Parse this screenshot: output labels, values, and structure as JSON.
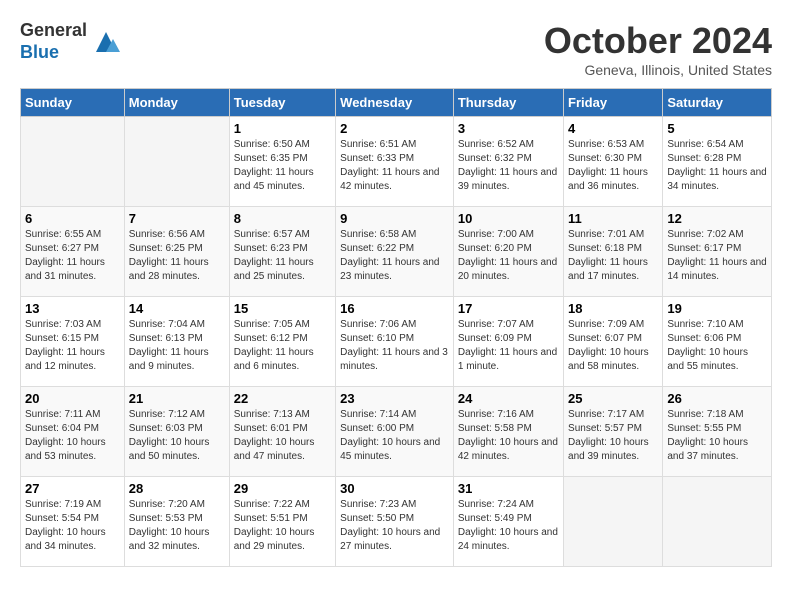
{
  "logo": {
    "general": "General",
    "blue": "Blue"
  },
  "title": "October 2024",
  "subtitle": "Geneva, Illinois, United States",
  "days_of_week": [
    "Sunday",
    "Monday",
    "Tuesday",
    "Wednesday",
    "Thursday",
    "Friday",
    "Saturday"
  ],
  "weeks": [
    [
      {
        "day": "",
        "empty": true
      },
      {
        "day": "",
        "empty": true
      },
      {
        "day": "1",
        "sunrise": "Sunrise: 6:50 AM",
        "sunset": "Sunset: 6:35 PM",
        "daylight": "Daylight: 11 hours and 45 minutes."
      },
      {
        "day": "2",
        "sunrise": "Sunrise: 6:51 AM",
        "sunset": "Sunset: 6:33 PM",
        "daylight": "Daylight: 11 hours and 42 minutes."
      },
      {
        "day": "3",
        "sunrise": "Sunrise: 6:52 AM",
        "sunset": "Sunset: 6:32 PM",
        "daylight": "Daylight: 11 hours and 39 minutes."
      },
      {
        "day": "4",
        "sunrise": "Sunrise: 6:53 AM",
        "sunset": "Sunset: 6:30 PM",
        "daylight": "Daylight: 11 hours and 36 minutes."
      },
      {
        "day": "5",
        "sunrise": "Sunrise: 6:54 AM",
        "sunset": "Sunset: 6:28 PM",
        "daylight": "Daylight: 11 hours and 34 minutes."
      }
    ],
    [
      {
        "day": "6",
        "sunrise": "Sunrise: 6:55 AM",
        "sunset": "Sunset: 6:27 PM",
        "daylight": "Daylight: 11 hours and 31 minutes."
      },
      {
        "day": "7",
        "sunrise": "Sunrise: 6:56 AM",
        "sunset": "Sunset: 6:25 PM",
        "daylight": "Daylight: 11 hours and 28 minutes."
      },
      {
        "day": "8",
        "sunrise": "Sunrise: 6:57 AM",
        "sunset": "Sunset: 6:23 PM",
        "daylight": "Daylight: 11 hours and 25 minutes."
      },
      {
        "day": "9",
        "sunrise": "Sunrise: 6:58 AM",
        "sunset": "Sunset: 6:22 PM",
        "daylight": "Daylight: 11 hours and 23 minutes."
      },
      {
        "day": "10",
        "sunrise": "Sunrise: 7:00 AM",
        "sunset": "Sunset: 6:20 PM",
        "daylight": "Daylight: 11 hours and 20 minutes."
      },
      {
        "day": "11",
        "sunrise": "Sunrise: 7:01 AM",
        "sunset": "Sunset: 6:18 PM",
        "daylight": "Daylight: 11 hours and 17 minutes."
      },
      {
        "day": "12",
        "sunrise": "Sunrise: 7:02 AM",
        "sunset": "Sunset: 6:17 PM",
        "daylight": "Daylight: 11 hours and 14 minutes."
      }
    ],
    [
      {
        "day": "13",
        "sunrise": "Sunrise: 7:03 AM",
        "sunset": "Sunset: 6:15 PM",
        "daylight": "Daylight: 11 hours and 12 minutes."
      },
      {
        "day": "14",
        "sunrise": "Sunrise: 7:04 AM",
        "sunset": "Sunset: 6:13 PM",
        "daylight": "Daylight: 11 hours and 9 minutes."
      },
      {
        "day": "15",
        "sunrise": "Sunrise: 7:05 AM",
        "sunset": "Sunset: 6:12 PM",
        "daylight": "Daylight: 11 hours and 6 minutes."
      },
      {
        "day": "16",
        "sunrise": "Sunrise: 7:06 AM",
        "sunset": "Sunset: 6:10 PM",
        "daylight": "Daylight: 11 hours and 3 minutes."
      },
      {
        "day": "17",
        "sunrise": "Sunrise: 7:07 AM",
        "sunset": "Sunset: 6:09 PM",
        "daylight": "Daylight: 11 hours and 1 minute."
      },
      {
        "day": "18",
        "sunrise": "Sunrise: 7:09 AM",
        "sunset": "Sunset: 6:07 PM",
        "daylight": "Daylight: 10 hours and 58 minutes."
      },
      {
        "day": "19",
        "sunrise": "Sunrise: 7:10 AM",
        "sunset": "Sunset: 6:06 PM",
        "daylight": "Daylight: 10 hours and 55 minutes."
      }
    ],
    [
      {
        "day": "20",
        "sunrise": "Sunrise: 7:11 AM",
        "sunset": "Sunset: 6:04 PM",
        "daylight": "Daylight: 10 hours and 53 minutes."
      },
      {
        "day": "21",
        "sunrise": "Sunrise: 7:12 AM",
        "sunset": "Sunset: 6:03 PM",
        "daylight": "Daylight: 10 hours and 50 minutes."
      },
      {
        "day": "22",
        "sunrise": "Sunrise: 7:13 AM",
        "sunset": "Sunset: 6:01 PM",
        "daylight": "Daylight: 10 hours and 47 minutes."
      },
      {
        "day": "23",
        "sunrise": "Sunrise: 7:14 AM",
        "sunset": "Sunset: 6:00 PM",
        "daylight": "Daylight: 10 hours and 45 minutes."
      },
      {
        "day": "24",
        "sunrise": "Sunrise: 7:16 AM",
        "sunset": "Sunset: 5:58 PM",
        "daylight": "Daylight: 10 hours and 42 minutes."
      },
      {
        "day": "25",
        "sunrise": "Sunrise: 7:17 AM",
        "sunset": "Sunset: 5:57 PM",
        "daylight": "Daylight: 10 hours and 39 minutes."
      },
      {
        "day": "26",
        "sunrise": "Sunrise: 7:18 AM",
        "sunset": "Sunset: 5:55 PM",
        "daylight": "Daylight: 10 hours and 37 minutes."
      }
    ],
    [
      {
        "day": "27",
        "sunrise": "Sunrise: 7:19 AM",
        "sunset": "Sunset: 5:54 PM",
        "daylight": "Daylight: 10 hours and 34 minutes."
      },
      {
        "day": "28",
        "sunrise": "Sunrise: 7:20 AM",
        "sunset": "Sunset: 5:53 PM",
        "daylight": "Daylight: 10 hours and 32 minutes."
      },
      {
        "day": "29",
        "sunrise": "Sunrise: 7:22 AM",
        "sunset": "Sunset: 5:51 PM",
        "daylight": "Daylight: 10 hours and 29 minutes."
      },
      {
        "day": "30",
        "sunrise": "Sunrise: 7:23 AM",
        "sunset": "Sunset: 5:50 PM",
        "daylight": "Daylight: 10 hours and 27 minutes."
      },
      {
        "day": "31",
        "sunrise": "Sunrise: 7:24 AM",
        "sunset": "Sunset: 5:49 PM",
        "daylight": "Daylight: 10 hours and 24 minutes."
      },
      {
        "day": "",
        "empty": true
      },
      {
        "day": "",
        "empty": true
      }
    ]
  ]
}
